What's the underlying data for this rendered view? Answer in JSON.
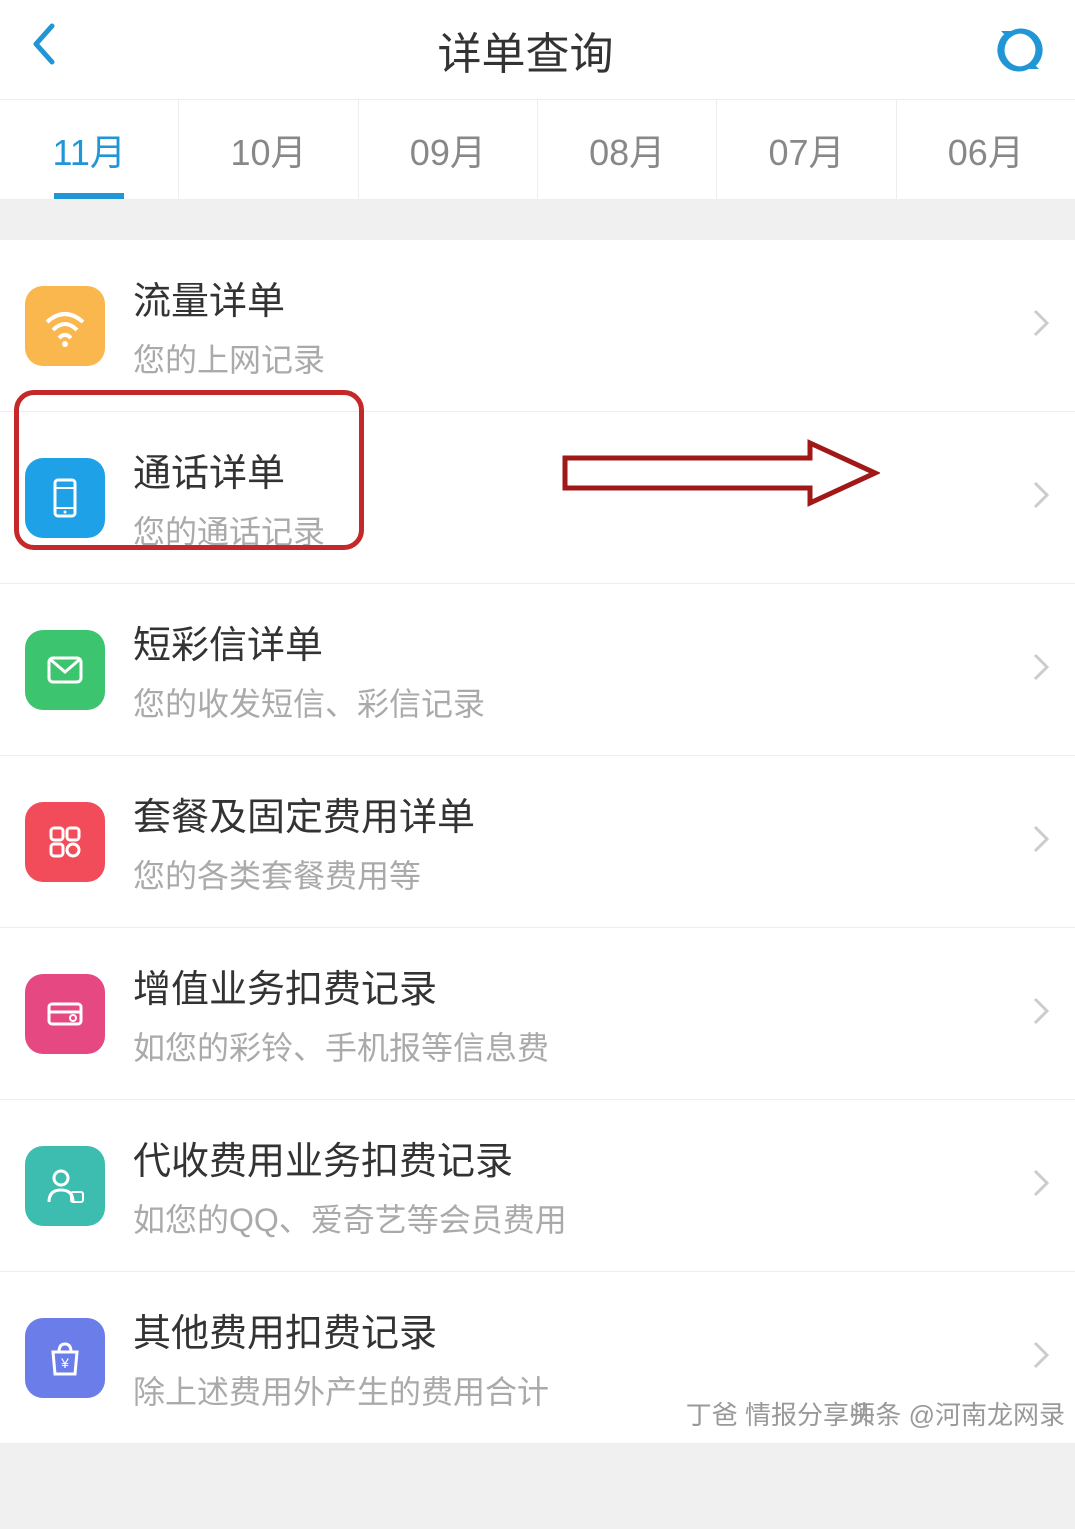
{
  "header": {
    "title": "详单查询"
  },
  "tabs": [
    {
      "label": "11月",
      "active": true
    },
    {
      "label": "10月",
      "active": false
    },
    {
      "label": "09月",
      "active": false
    },
    {
      "label": "08月",
      "active": false
    },
    {
      "label": "07月",
      "active": false
    },
    {
      "label": "06月",
      "active": false
    }
  ],
  "items": [
    {
      "icon": "wifi",
      "color": "bg-orange",
      "title": "流量详单",
      "subtitle": "您的上网记录"
    },
    {
      "icon": "phone",
      "color": "bg-blue",
      "title": "通话详单",
      "subtitle": "您的通话记录"
    },
    {
      "icon": "mail",
      "color": "bg-green",
      "title": "短彩信详单",
      "subtitle": "您的收发短信、彩信记录"
    },
    {
      "icon": "grid",
      "color": "bg-red",
      "title": "套餐及固定费用详单",
      "subtitle": "您的各类套餐费用等"
    },
    {
      "icon": "card",
      "color": "bg-pink",
      "title": "增值业务扣费记录",
      "subtitle": "如您的彩铃、手机报等信息费"
    },
    {
      "icon": "person",
      "color": "bg-teal",
      "title": "代收费用业务扣费记录",
      "subtitle": "如您的QQ、爱奇艺等会员费用"
    },
    {
      "icon": "bag",
      "color": "bg-indigo",
      "title": "其他费用扣费记录",
      "subtitle": "除上述费用外产生的费用合计"
    }
  ],
  "watermark": {
    "text1": "头条 @河南龙网录",
    "text2": "丁爸 情报分享师"
  }
}
